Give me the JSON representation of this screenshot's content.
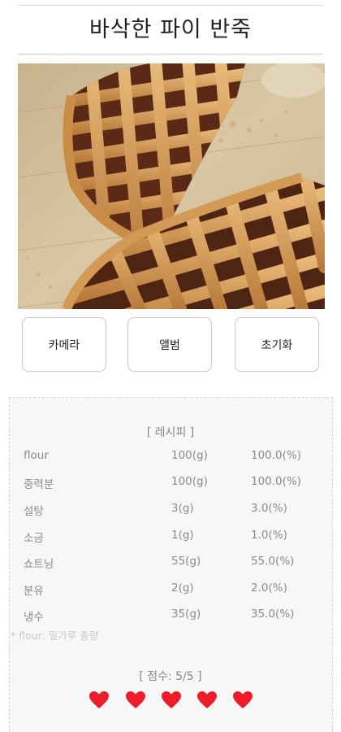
{
  "header": {
    "title": "바삭한 파이 반죽"
  },
  "photo": {
    "description": "lattice-top pies on wooden board"
  },
  "actions": {
    "camera_label": "카메라",
    "album_label": "앨범",
    "reset_label": "초기화"
  },
  "recipe": {
    "heading": "[ 레시피 ]",
    "rows": [
      {
        "name": "flour",
        "amount": "100(g)",
        "percent": "100.0(%)"
      },
      {
        "name": "중력분",
        "amount": "100(g)",
        "percent": "100.0(%)"
      },
      {
        "name": "설탕",
        "amount": "3(g)",
        "percent": "3.0(%)"
      },
      {
        "name": "소금",
        "amount": "1(g)",
        "percent": "1.0(%)"
      },
      {
        "name": "쇼트닝",
        "amount": "55(g)",
        "percent": "55.0(%)"
      },
      {
        "name": "분유",
        "amount": "2(g)",
        "percent": "2.0(%)"
      },
      {
        "name": "냉수",
        "amount": "35(g)",
        "percent": "35.0(%)"
      }
    ],
    "note": "* flour: 밀가루 총량"
  },
  "score": {
    "label": "[ 점수: 5/5 ]",
    "value": 5,
    "max": 5,
    "heart_color": "#ee1c2a"
  }
}
